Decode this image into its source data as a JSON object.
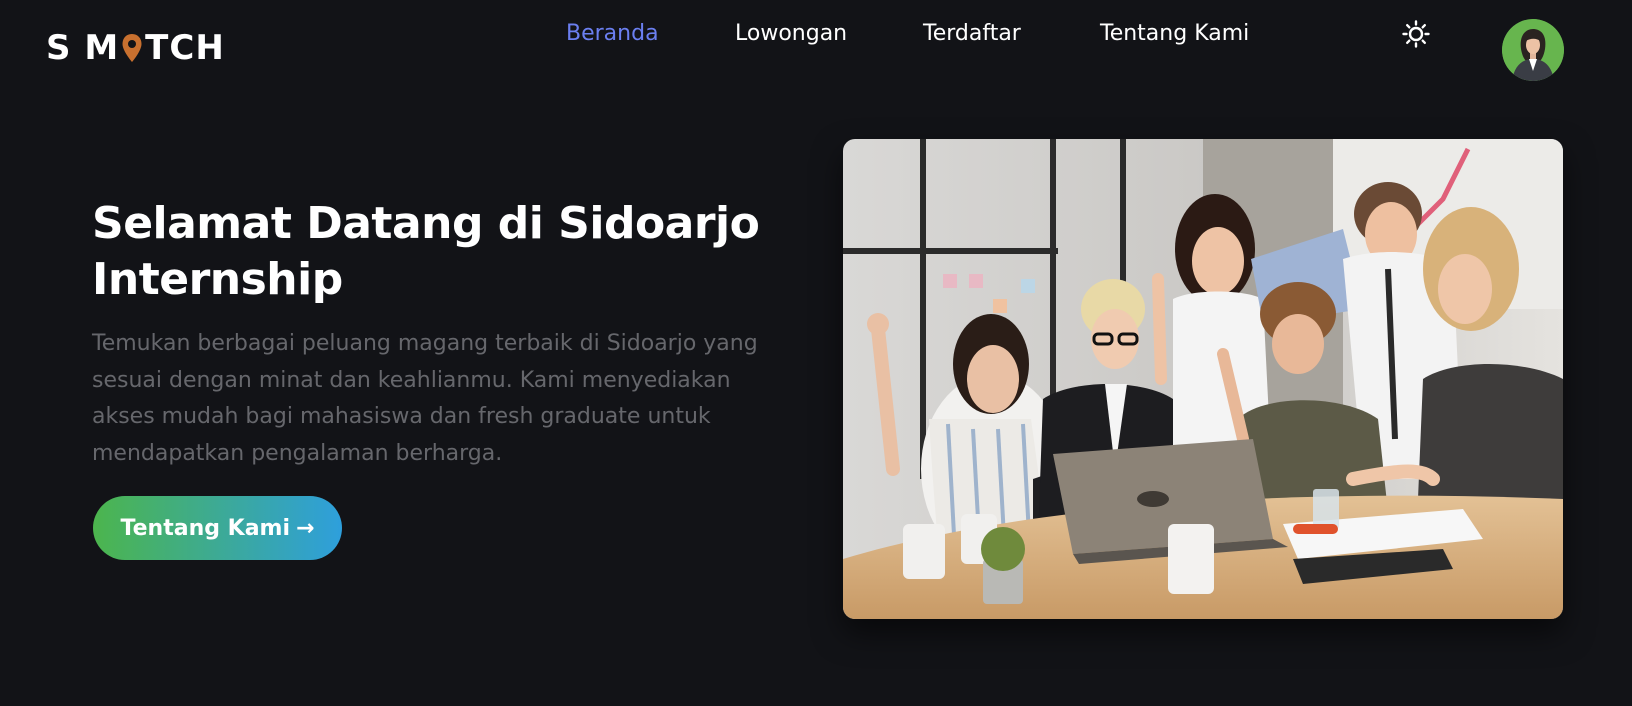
{
  "brand": {
    "logo_left": "S M",
    "logo_right": "TCH",
    "pin_color": "#c8702f"
  },
  "nav": {
    "items": [
      {
        "label": "Beranda",
        "active": true
      },
      {
        "label": "Lowongan",
        "active": false
      },
      {
        "label": "Terdaftar",
        "active": false
      },
      {
        "label": "Tentang Kami",
        "active": false
      }
    ],
    "active_color": "#6b7ff0"
  },
  "theme_toggle": {
    "icon": "sun-icon"
  },
  "user": {
    "avatar_icon": "user-avatar"
  },
  "hero": {
    "title": "Selamat Datang di Sidoarjo Internship",
    "description": "Temukan berbagai peluang magang terbaik di Sidoarjo yang sesuai dengan minat dan keahlianmu. Kami menyediakan akses mudah bagi mahasiswa dan fresh graduate untuk mendapatkan pengalaman berharga.",
    "cta_label": "Tentang Kami",
    "cta_arrow": "→",
    "image_icon": "team-celebrating-photo"
  },
  "colors": {
    "background": "#121317",
    "cta_gradient_start": "#4cb54d",
    "cta_gradient_end": "#2e9fdc",
    "muted_text": "#66676c"
  }
}
